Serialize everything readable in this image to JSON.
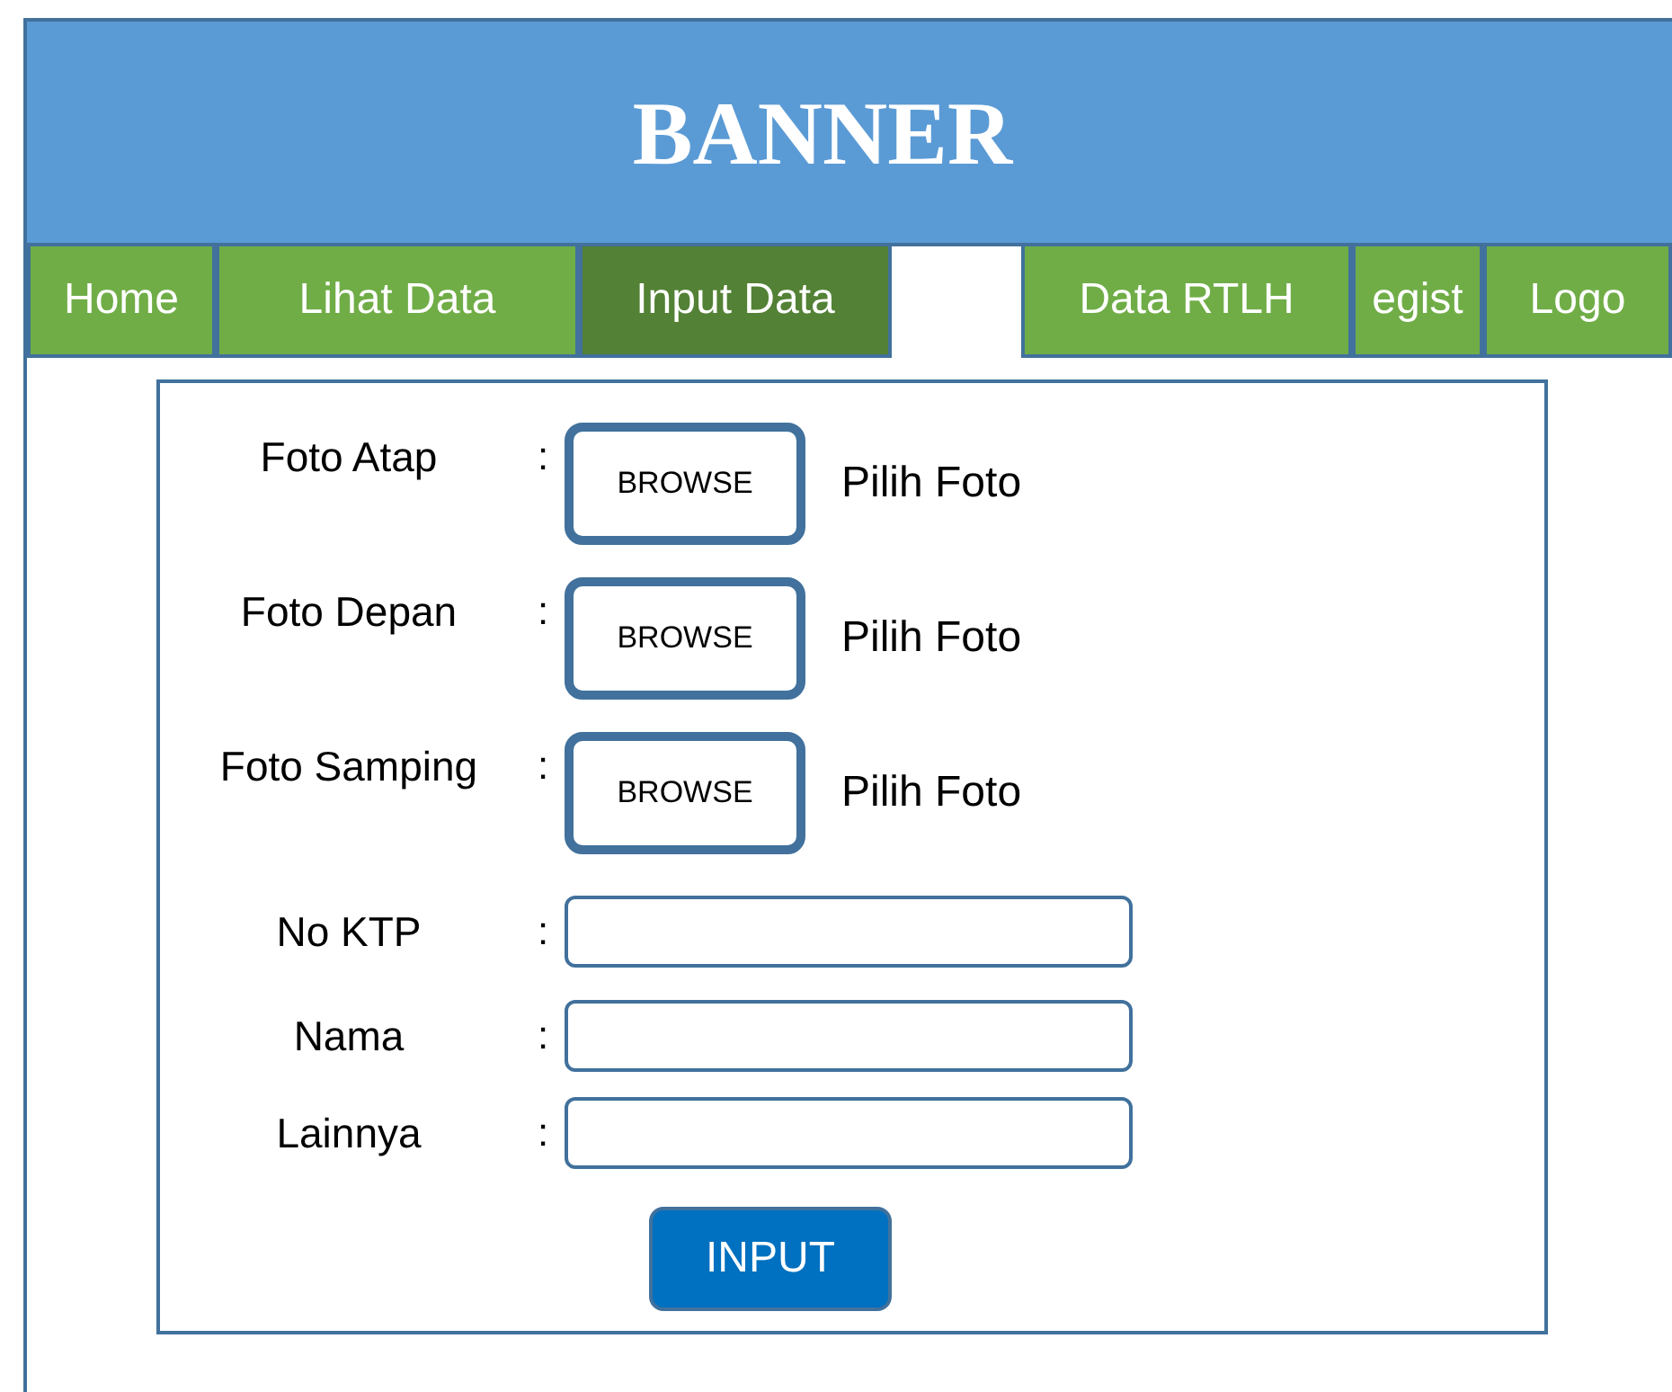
{
  "banner": {
    "title": "BANNER"
  },
  "nav": {
    "tabs": [
      {
        "label": "Home",
        "selected": false,
        "gap_before": false
      },
      {
        "label": "Lihat Data",
        "selected": false,
        "gap_before": false
      },
      {
        "label": "Input Data",
        "selected": true,
        "gap_before": false
      },
      {
        "label": "Data RTLH",
        "selected": false,
        "gap_before": true
      },
      {
        "label": "egist",
        "selected": false,
        "gap_before": false
      },
      {
        "label": "Logo",
        "selected": false,
        "gap_before": false
      }
    ]
  },
  "form": {
    "rows": [
      {
        "kind": "file",
        "label": "Foto Atap",
        "colon": ":",
        "button": "BROWSE",
        "hint": "Pilih Foto"
      },
      {
        "kind": "file",
        "label": "Foto Depan",
        "colon": ":",
        "button": "BROWSE",
        "hint": "Pilih Foto"
      },
      {
        "kind": "file",
        "label": "Foto Samping",
        "colon": ":",
        "button": "BROWSE",
        "hint": "Pilih Foto"
      },
      {
        "kind": "text",
        "label": "No KTP",
        "colon": ":"
      },
      {
        "kind": "text",
        "label": "Nama",
        "colon": ":"
      },
      {
        "kind": "text",
        "label": "Lainnya",
        "colon": ":"
      }
    ],
    "submit": "INPUT"
  }
}
